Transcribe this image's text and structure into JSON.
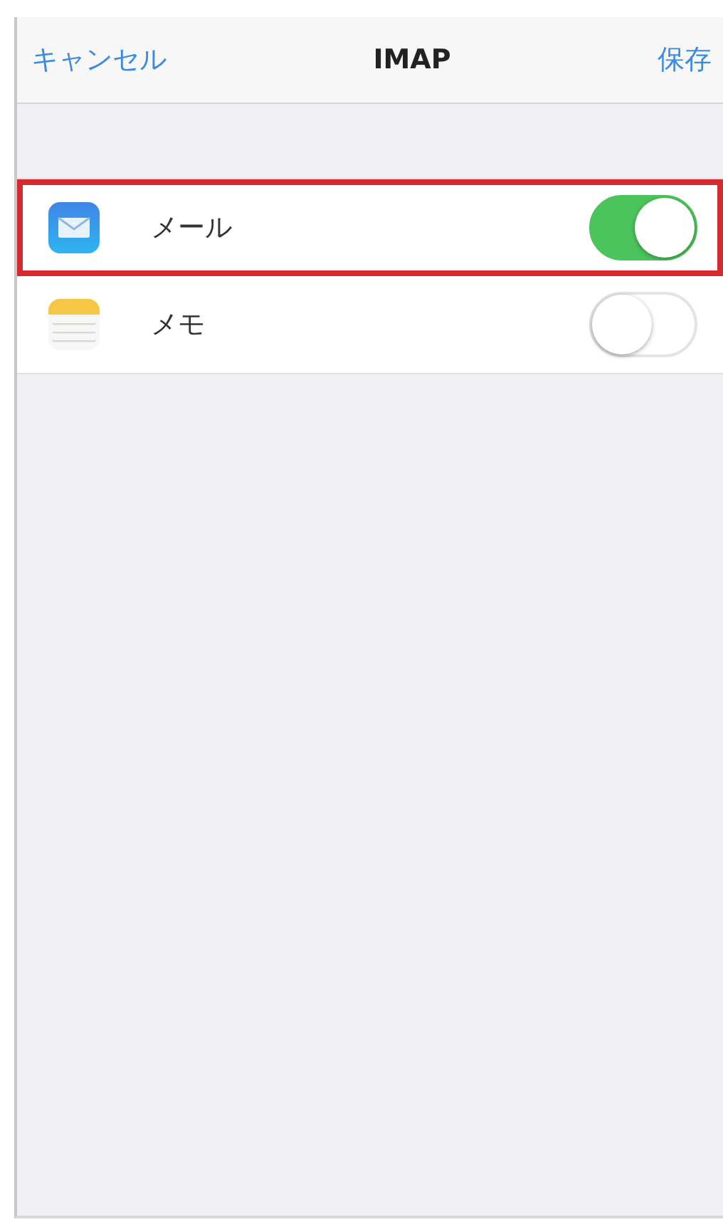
{
  "nav_bar": {
    "cancel": "キャンセル",
    "title": "IMAP",
    "save": "保存"
  },
  "rows": [
    {
      "kind": "mail",
      "label": "メール",
      "on": true,
      "highlighted": true
    },
    {
      "kind": "notes",
      "label": "メモ",
      "on": false,
      "highlighted": false
    }
  ]
}
